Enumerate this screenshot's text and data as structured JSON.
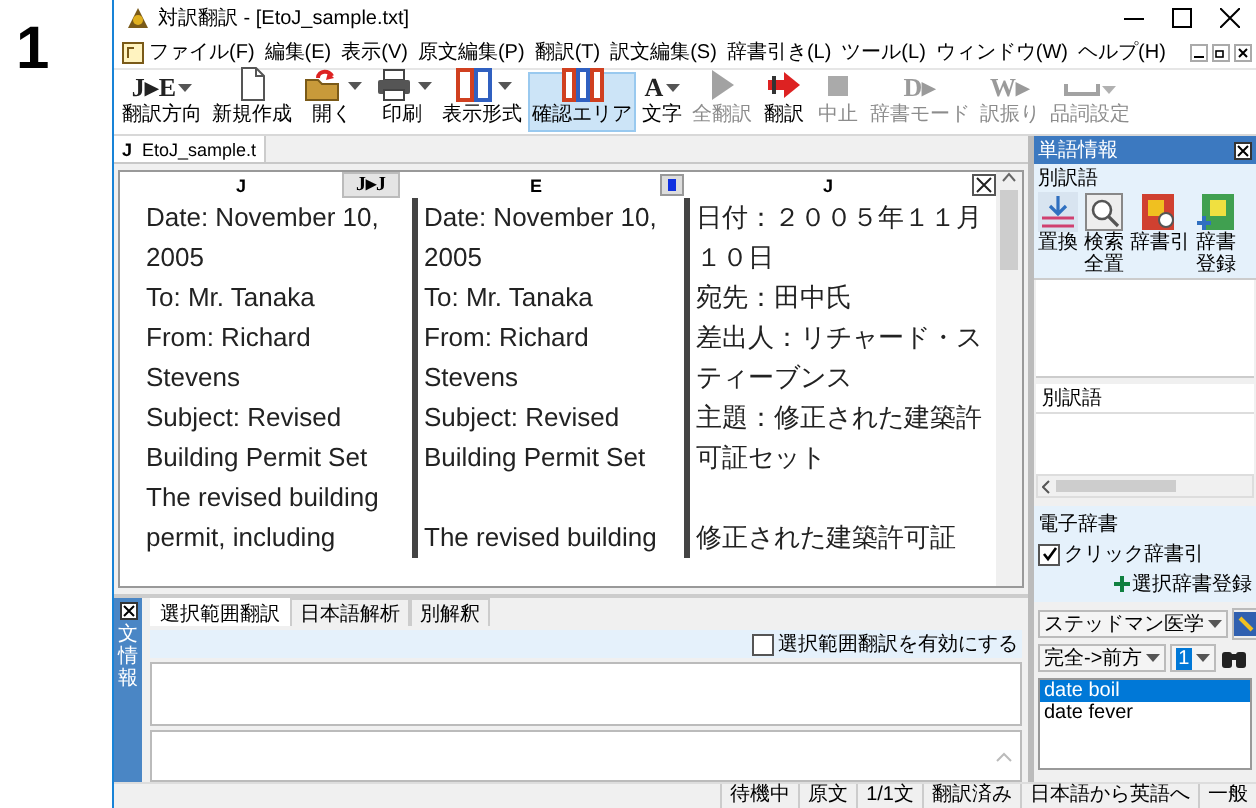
{
  "step_number": "1",
  "window": {
    "title": "対訳翻訳 - [EtoJ_sample.txt]"
  },
  "menu": [
    "ファイル(F)",
    "編集(E)",
    "表示(V)",
    "原文編集(P)",
    "翻訳(T)",
    "訳文編集(S)",
    "辞書引き(L)",
    "ツール(L)",
    "ウィンドウ(W)",
    "ヘルプ(H)"
  ],
  "toolbar": [
    {
      "label": "翻訳方向",
      "glyph": "J▸E",
      "dropdown": true,
      "selected": false,
      "disabled": false
    },
    {
      "label": "新規作成",
      "dropdown": false,
      "selected": false,
      "disabled": false
    },
    {
      "label": "開く",
      "dropdown": true,
      "selected": false,
      "disabled": false
    },
    {
      "label": "印刷",
      "dropdown": true,
      "selected": false,
      "disabled": false
    },
    {
      "label": "表示形式",
      "dropdown": true,
      "selected": false,
      "disabled": false
    },
    {
      "label": "確認エリア",
      "dropdown": false,
      "selected": true,
      "disabled": false
    },
    {
      "label": "文字",
      "glyph": "A",
      "dropdown": true,
      "selected": false,
      "disabled": false
    },
    {
      "label": "全翻訳",
      "dropdown": false,
      "selected": false,
      "disabled": true
    },
    {
      "label": "翻訳",
      "dropdown": false,
      "selected": false,
      "disabled": false
    },
    {
      "label": "中止",
      "dropdown": false,
      "selected": false,
      "disabled": true
    },
    {
      "label": "辞書モード",
      "glyph": "D▸",
      "dropdown": false,
      "selected": false,
      "disabled": true
    },
    {
      "label": "訳振り",
      "glyph": "W▸",
      "dropdown": false,
      "selected": false,
      "disabled": true
    },
    {
      "label": "品詞設定",
      "dropdown": true,
      "selected": false,
      "disabled": true
    }
  ],
  "document_tab": {
    "badge": "J",
    "name": "EtoJ_sample.t"
  },
  "editor": {
    "columns": [
      {
        "language": "J",
        "tool": {
          "kind": "swap",
          "text": "J▸J"
        }
      },
      {
        "language": "E",
        "tool": {
          "kind": "color"
        }
      },
      {
        "language": "J",
        "tool": {
          "kind": "close"
        }
      }
    ],
    "rows": [
      [
        "Date: November 10, 2005",
        "Date: November 10, 2005",
        "日付：２００５年１１月１０日"
      ],
      [
        "To: Mr. Tanaka",
        "To: Mr. Tanaka",
        "宛先：田中氏"
      ],
      [
        "From: Richard Stevens",
        "From: Richard Stevens",
        "差出人：リチャード・スティーブンス"
      ],
      [
        "Subject: Revised Building Permit Set",
        "Subject: Revised Building Permit Set",
        "主題：修正された建築許可証セット"
      ],
      [
        "The revised building permit, including",
        "The revised building",
        "修正された建築許可証"
      ]
    ]
  },
  "sentence_panel": {
    "title": "文情報",
    "tabs": [
      {
        "label": "選択範囲翻訳",
        "selected": true
      },
      {
        "label": "日本語解析",
        "selected": false
      },
      {
        "label": "別解釈",
        "selected": false
      }
    ],
    "enable_option": {
      "label": "選択範囲翻訳を有効にする",
      "checked": false
    }
  },
  "word_panel": {
    "title": "単語情報",
    "alternatives_label": "別訳語",
    "tools": [
      "置換",
      "検索全置",
      "辞書引",
      "辞書登録"
    ],
    "alternatives_header": "別訳語",
    "dictionary": {
      "label": "電子辞書",
      "click_lookup": {
        "label": "クリック辞書引",
        "checked": true
      },
      "register_link": "選択辞書登録",
      "dictionary_select": "ステッドマン医学",
      "match_select": "完全->前方",
      "count_select": "1",
      "results": [
        {
          "text": "date boil",
          "selected": true
        },
        {
          "text": "date fever",
          "selected": false
        }
      ]
    }
  },
  "status_bar": [
    "待機中",
    "原文",
    "1/1文",
    "翻訳済み",
    "日本語から英語へ",
    "一般"
  ]
}
